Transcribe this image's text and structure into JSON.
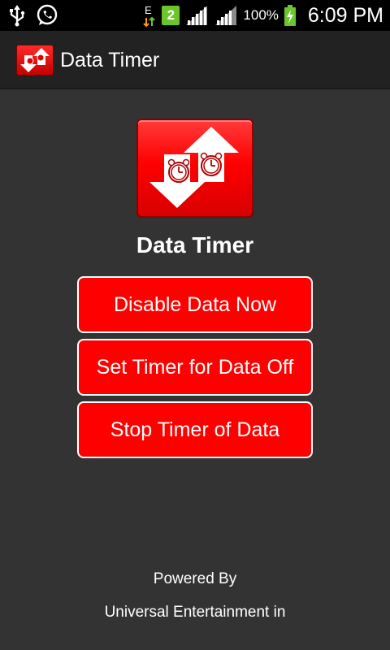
{
  "status_bar": {
    "icons_left": [
      "usb-icon",
      "whatsapp-icon"
    ],
    "icons_right": [
      "data-e-icon",
      "sim-2-icon",
      "signal-icon",
      "signal-icon-2",
      "battery-charging-icon"
    ],
    "network_letter": "E",
    "sim_number": "2",
    "battery": "100%",
    "time": "6:09 PM",
    "battery_color": "#6bc62b"
  },
  "action_bar": {
    "title": "Data Timer",
    "icon": "data-timer-app-icon"
  },
  "main": {
    "logo_icon": "data-timer-logo-icon",
    "app_name": "Data Timer",
    "buttons": [
      {
        "label": "Disable Data Now"
      },
      {
        "label": "Set Timer for Data Off"
      },
      {
        "label": "Stop Timer of Data"
      }
    ],
    "accent_color": "#ff0000"
  },
  "footer": {
    "line1": "Powered By",
    "line2": "Universal Entertainment in"
  }
}
